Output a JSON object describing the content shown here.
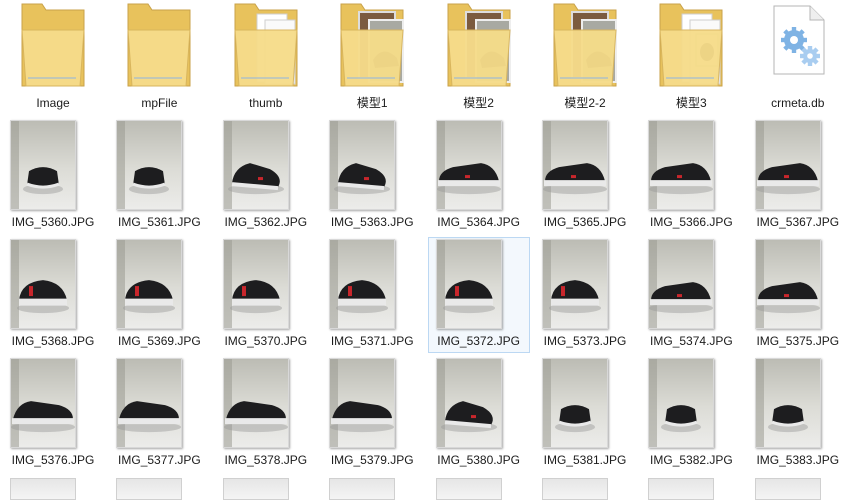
{
  "folders": [
    {
      "label": "Image",
      "variant": "plain"
    },
    {
      "label": "mpFile",
      "variant": "plain"
    },
    {
      "label": "thumb",
      "variant": "papers"
    },
    {
      "label": "模型1",
      "variant": "photos"
    },
    {
      "label": "模型2",
      "variant": "photos"
    },
    {
      "label": "模型2-2",
      "variant": "photos"
    },
    {
      "label": "模型3",
      "variant": "papers-photo"
    },
    {
      "label": "crmeta.db",
      "variant": "db-file"
    }
  ],
  "images": [
    {
      "label": "IMG_5360.JPG",
      "angle": "front-far"
    },
    {
      "label": "IMG_5361.JPG",
      "angle": "front-far"
    },
    {
      "label": "IMG_5362.JPG",
      "angle": "three-quarter"
    },
    {
      "label": "IMG_5363.JPG",
      "angle": "three-quarter"
    },
    {
      "label": "IMG_5364.JPG",
      "angle": "side-left"
    },
    {
      "label": "IMG_5365.JPG",
      "angle": "side-left"
    },
    {
      "label": "IMG_5366.JPG",
      "angle": "side-left"
    },
    {
      "label": "IMG_5367.JPG",
      "angle": "side-left"
    },
    {
      "label": "IMG_5368.JPG",
      "angle": "heel"
    },
    {
      "label": "IMG_5369.JPG",
      "angle": "heel"
    },
    {
      "label": "IMG_5370.JPG",
      "angle": "heel"
    },
    {
      "label": "IMG_5371.JPG",
      "angle": "heel"
    },
    {
      "label": "IMG_5372.JPG",
      "angle": "heel",
      "selected": true
    },
    {
      "label": "IMG_5373.JPG",
      "angle": "heel"
    },
    {
      "label": "IMG_5374.JPG",
      "angle": "side-left"
    },
    {
      "label": "IMG_5375.JPG",
      "angle": "side-left"
    },
    {
      "label": "IMG_5376.JPG",
      "angle": "side-right"
    },
    {
      "label": "IMG_5377.JPG",
      "angle": "side-right"
    },
    {
      "label": "IMG_5378.JPG",
      "angle": "side-right"
    },
    {
      "label": "IMG_5379.JPG",
      "angle": "side-right"
    },
    {
      "label": "IMG_5380.JPG",
      "angle": "three-quarter"
    },
    {
      "label": "IMG_5381.JPG",
      "angle": "front-far"
    },
    {
      "label": "IMG_5382.JPG",
      "angle": "front-far"
    },
    {
      "label": "IMG_5383.JPG",
      "angle": "front-far"
    }
  ],
  "colors": {
    "folder_back": "#e8c25c",
    "folder_front": "#f6dc8a",
    "selection_fill": "#f3f8fd",
    "selection_border": "#bcd8f3",
    "shoe_upper": "#1d1d1f",
    "shoe_sole": "#e9e9e9",
    "accent_red": "#c8262c",
    "backdrop": "#dcdcd6"
  }
}
